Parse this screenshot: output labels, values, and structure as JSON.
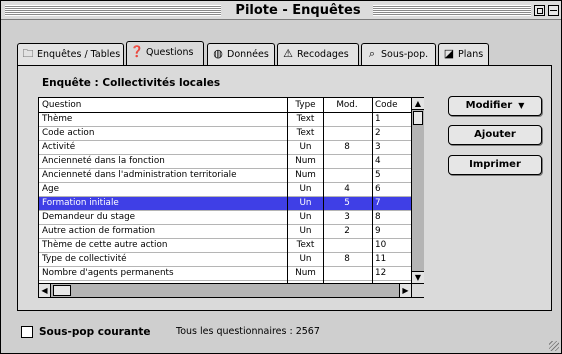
{
  "window": {
    "title": "Pilote - Enquêtes"
  },
  "tabs": [
    {
      "label": "Enquêtes / Tables",
      "icon": "folder-icon",
      "glyph": "🗀",
      "active": false
    },
    {
      "label": "Questions",
      "icon": "question-icon",
      "glyph": "❓",
      "active": true
    },
    {
      "label": "Données",
      "icon": "data-icon",
      "glyph": "◍",
      "active": false
    },
    {
      "label": "Recodages",
      "icon": "recode-icon",
      "glyph": "⚠",
      "active": false
    },
    {
      "label": "Sous-pop.",
      "icon": "search-icon",
      "glyph": "⌕",
      "active": false
    },
    {
      "label": "Plans",
      "icon": "plan-icon",
      "glyph": "◪",
      "active": false
    }
  ],
  "survey": {
    "label": "Enquête : Collectivités locales"
  },
  "table": {
    "headers": [
      "Question",
      "Type",
      "Mod.",
      "Code"
    ],
    "rows": [
      {
        "question": "Thème",
        "type": "Text",
        "mod": "",
        "code": "1"
      },
      {
        "question": "Code action",
        "type": "Text",
        "mod": "",
        "code": "2"
      },
      {
        "question": "Activité",
        "type": "Un",
        "mod": "8",
        "code": "3"
      },
      {
        "question": "Ancienneté dans la fonction",
        "type": "Num",
        "mod": "",
        "code": "4"
      },
      {
        "question": "Ancienneté dans l'administration territoriale",
        "type": "Num",
        "mod": "",
        "code": "5"
      },
      {
        "question": "Age",
        "type": "Un",
        "mod": "4",
        "code": "6"
      },
      {
        "question": "Formation initiale",
        "type": "Un",
        "mod": "5",
        "code": "7",
        "selected": true
      },
      {
        "question": "Demandeur du stage",
        "type": "Un",
        "mod": "3",
        "code": "8"
      },
      {
        "question": "Autre action de formation",
        "type": "Un",
        "mod": "2",
        "code": "9"
      },
      {
        "question": "Thème de cette autre action",
        "type": "Text",
        "mod": "",
        "code": "10"
      },
      {
        "question": "Type de collectivité",
        "type": "Un",
        "mod": "8",
        "code": "11"
      },
      {
        "question": "Nombre d'agents permanents",
        "type": "Num",
        "mod": "",
        "code": "12"
      }
    ]
  },
  "buttons": {
    "modify": "Modifier",
    "add": "Ajouter",
    "print": "Imprimer"
  },
  "footer": {
    "checkbox_label": "Sous-pop courante",
    "info": "Tous les questionnaires : 2567"
  },
  "colors": {
    "selection": "#3f3fe6",
    "window": "#cfcfcf"
  }
}
